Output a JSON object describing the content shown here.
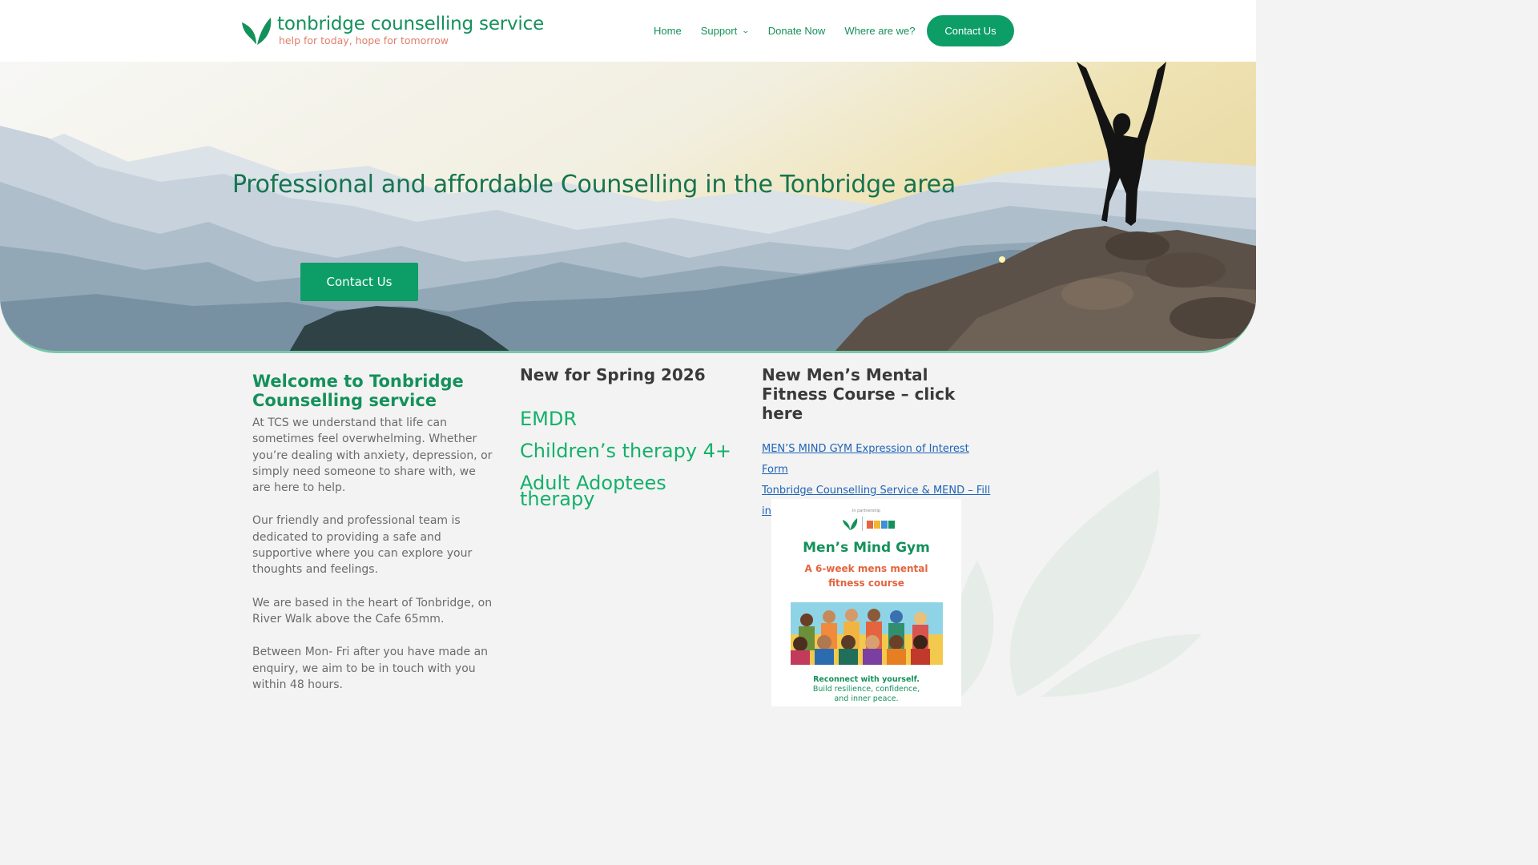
{
  "site": {
    "name": "tonbridge counselling service",
    "tagline": "help for today, hope for tomorrow"
  },
  "nav": {
    "items": [
      {
        "label": "Home"
      },
      {
        "label": "Support",
        "has_dropdown": true
      },
      {
        "label": "Donate Now"
      },
      {
        "label": "Where are we?"
      }
    ],
    "contact_button": "Contact Us"
  },
  "hero": {
    "title": "Professional and affordable Counselling in the Tonbridge area",
    "button": "Contact Us"
  },
  "welcome": {
    "heading": "Welcome to Tonbridge Counselling service",
    "paragraphs": [
      "At TCS we understand that life can sometimes feel overwhelming.  Whether you’re dealing with anxiety, depression, or simply need someone to share with, we are here to help.",
      "Our friendly and professional team is dedicated to providing a safe and supportive where you can explore your thoughts and feelings.",
      "We are based in the heart of Tonbridge, on River Walk above the Cafe 65mm.",
      "Between Mon- Fri after you have made an enquiry, we aim to be in touch with you within 48 hours."
    ]
  },
  "spring": {
    "heading": "New for Spring 2026",
    "items": [
      "EMDR",
      "Children’s therapy 4+",
      "Adult Adoptees therapy"
    ]
  },
  "mens": {
    "heading": "New Men’s Mental Fitness Course – click here",
    "links": [
      "MEN’S MIND GYM Expression of Interest Form",
      "Tonbridge Counselling Service & MEND  – Fill in form"
    ],
    "poster": {
      "partner_text": "In partnership",
      "title": "Men’s Mind Gym",
      "subtitle": "A 6-week mens mental fitness course",
      "footer_line1": "Reconnect with yourself.",
      "footer_line2": "Build resilience, confidence,",
      "footer_line3": "and inner peace."
    }
  },
  "colors": {
    "brand_green": "#14915a",
    "button_green": "#0d9e68",
    "tagline_orange": "#e07f6a",
    "link_blue": "#1e63b8",
    "heading_dark": "#3a3a3a"
  },
  "icons": {
    "logo": "leaf-logo-icon",
    "support_dropdown": "chevron-down-icon"
  }
}
